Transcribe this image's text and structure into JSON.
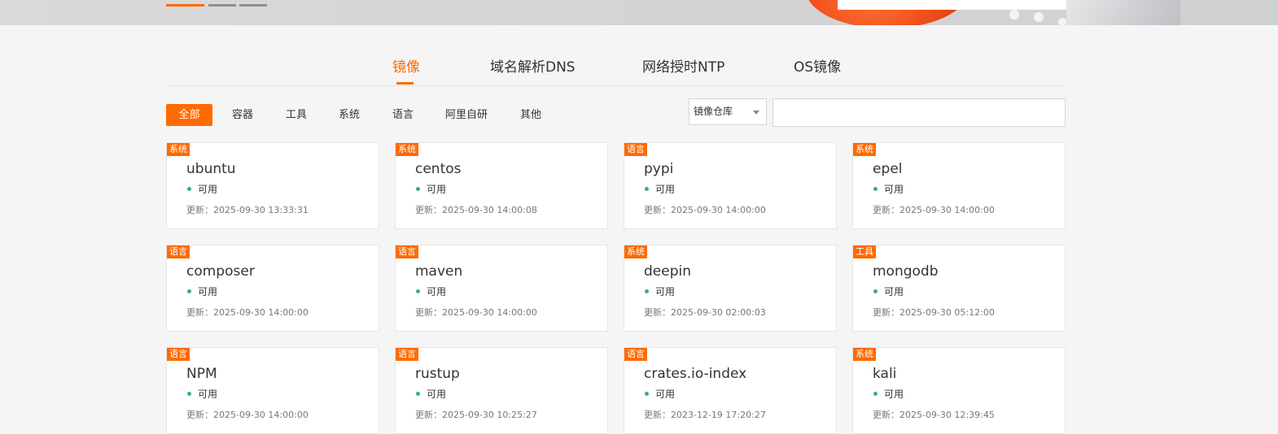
{
  "tabs": [
    {
      "label": "镜像",
      "active": true
    },
    {
      "label": "域名解析DNS",
      "active": false
    },
    {
      "label": "网络授时NTP",
      "active": false
    },
    {
      "label": "OS镜像",
      "active": false
    }
  ],
  "filters": [
    {
      "label": "全部",
      "active": true
    },
    {
      "label": "容器",
      "active": false
    },
    {
      "label": "工具",
      "active": false
    },
    {
      "label": "系统",
      "active": false
    },
    {
      "label": "语言",
      "active": false
    },
    {
      "label": "阿里自研",
      "active": false
    },
    {
      "label": "其他",
      "active": false
    }
  ],
  "search": {
    "select_value": "镜像仓库",
    "input_value": ""
  },
  "colors": {
    "accent": "#ff6a00",
    "status_ok": "#36b36a"
  },
  "mirrors": [
    {
      "tag": "系统",
      "name": "ubuntu",
      "status": "可用",
      "updated": "更新：2025-09-30 13:33:31"
    },
    {
      "tag": "系统",
      "name": "centos",
      "status": "可用",
      "updated": "更新：2025-09-30 14:00:08"
    },
    {
      "tag": "语言",
      "name": "pypi",
      "status": "可用",
      "updated": "更新：2025-09-30 14:00:00"
    },
    {
      "tag": "系统",
      "name": "epel",
      "status": "可用",
      "updated": "更新：2025-09-30 14:00:00"
    },
    {
      "tag": "语言",
      "name": "composer",
      "status": "可用",
      "updated": "更新：2025-09-30 14:00:00"
    },
    {
      "tag": "语言",
      "name": "maven",
      "status": "可用",
      "updated": "更新：2025-09-30 14:00:00"
    },
    {
      "tag": "系统",
      "name": "deepin",
      "status": "可用",
      "updated": "更新：2025-09-30 02:00:03"
    },
    {
      "tag": "工具",
      "name": "mongodb",
      "status": "可用",
      "updated": "更新：2025-09-30 05:12:00"
    },
    {
      "tag": "语言",
      "name": "NPM",
      "status": "可用",
      "updated": "更新：2025-09-30 14:00:00"
    },
    {
      "tag": "语言",
      "name": "rustup",
      "status": "可用",
      "updated": "更新：2025-09-30 10:25:27"
    },
    {
      "tag": "语言",
      "name": "crates.io-index",
      "status": "可用",
      "updated": "更新：2023-12-19 17:20:27"
    },
    {
      "tag": "系统",
      "name": "kali",
      "status": "可用",
      "updated": "更新：2025-09-30 12:39:45"
    }
  ]
}
